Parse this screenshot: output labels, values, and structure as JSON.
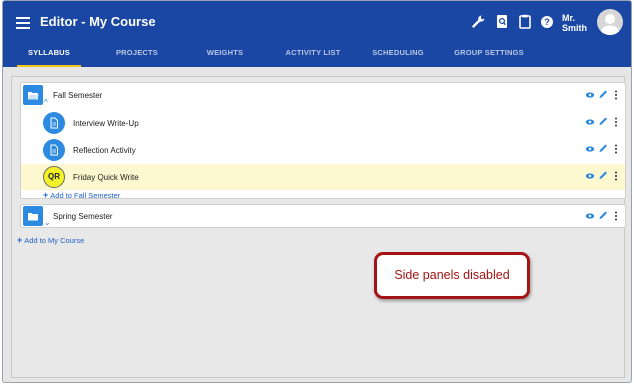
{
  "header": {
    "title": "Editor - My Course",
    "user_name_line1": "Mr.",
    "user_name_line2": "Smith",
    "icons": [
      "wrench-icon",
      "search-doc-icon",
      "clipboard-icon",
      "help-icon"
    ]
  },
  "tabs": [
    {
      "label": "SYLLABUS",
      "active": true
    },
    {
      "label": "PROJECTS"
    },
    {
      "label": "WEIGHTS"
    },
    {
      "label": "ACTIVITY LIST"
    },
    {
      "label": "SCHEDULING"
    },
    {
      "label": "GROUP SETTINGS"
    }
  ],
  "semesters": [
    {
      "title": "Fall Semester",
      "items": [
        {
          "title": "Interview Write-Up",
          "type": "document"
        },
        {
          "title": "Reflection Activity",
          "type": "document"
        },
        {
          "title": "Friday Quick Write",
          "type": "quick-write",
          "badge": "QR",
          "highlighted": true
        }
      ],
      "add_label": "Add to Fall Semester"
    },
    {
      "title": "Spring Semester",
      "items": []
    }
  ],
  "add_course_label": "Add to My Course",
  "callout": "Side panels disabled",
  "colors": {
    "header": "#1a47a3",
    "accent": "#2c8be0",
    "tab_indicator": "#f5c518",
    "highlight_row": "#fdf8cf",
    "callout": "#a51414"
  }
}
